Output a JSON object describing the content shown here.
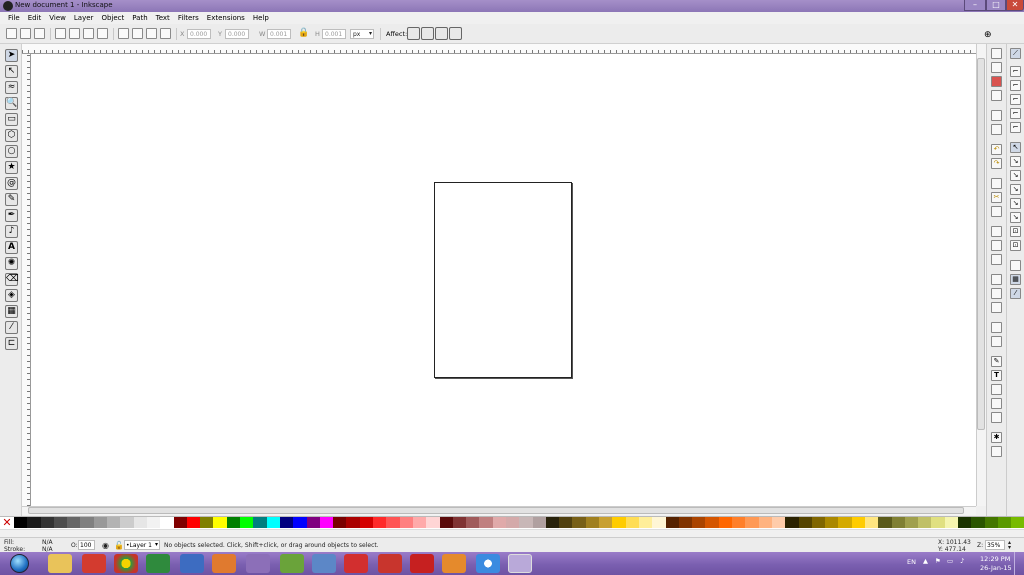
{
  "window": {
    "title": "New document 1 - Inkscape",
    "minimize": "–",
    "maximize": "□",
    "close": "✕"
  },
  "menu": [
    "File",
    "Edit",
    "View",
    "Layer",
    "Object",
    "Path",
    "Text",
    "Filters",
    "Extensions",
    "Help"
  ],
  "toolbar": {
    "x_label": "X",
    "x_value": "0.000",
    "y_label": "Y",
    "y_value": "0.000",
    "w_label": "W",
    "w_value": "0.001",
    "h_label": "H",
    "h_value": "0.001",
    "unit": "px",
    "affect_label": "Affect:"
  },
  "status": {
    "fill_label": "Fill:",
    "fill_value": "N/A",
    "stroke_label": "Stroke:",
    "stroke_value": "N/A",
    "opacity_label": "O:",
    "opacity_value": "100",
    "layer": "•Layer 1",
    "message": "No objects selected. Click, Shift+click, or drag around objects to select.",
    "x_coord": "X: 1011.43",
    "y_coord": "Y: 477.14",
    "zoom_label": "Z:",
    "zoom_value": "35%"
  },
  "tray": {
    "lang": "EN",
    "time": "12:29 PM",
    "date": "26-Jan-15"
  },
  "palette": [
    "#000000",
    "#1a1a1a",
    "#333333",
    "#4d4d4d",
    "#666666",
    "#808080",
    "#999999",
    "#b3b3b3",
    "#cccccc",
    "#e6e6e6",
    "#f2f2f2",
    "#ffffff",
    "#800000",
    "#ff0000",
    "#808000",
    "#ffff00",
    "#008000",
    "#00ff00",
    "#008080",
    "#00ffff",
    "#000080",
    "#0000ff",
    "#800080",
    "#ff00ff",
    "#7a0000",
    "#aa0000",
    "#d40000",
    "#ff2a2a",
    "#ff5555",
    "#ff8080",
    "#ffaaaa",
    "#ffd5d5",
    "#5a0a0a",
    "#803333",
    "#a05a5a",
    "#c08080",
    "#e0aaaa",
    "#d4aaaa",
    "#c8b7b7",
    "#b0a0a0",
    "#28220b",
    "#504010",
    "#786018",
    "#a08020",
    "#c8a030",
    "#ffcc00",
    "#ffdd55",
    "#ffee99",
    "#fff6d5",
    "#552200",
    "#803300",
    "#aa4400",
    "#d45500",
    "#ff6600",
    "#ff7f2a",
    "#ff9955",
    "#ffb380",
    "#ffccaa",
    "#2b2200",
    "#554400",
    "#806600",
    "#aa8800",
    "#d4aa00",
    "#ffcc00",
    "#ffe680",
    "#5a5a1a",
    "#808033",
    "#a0a04d",
    "#c0c066",
    "#e0e080",
    "#f5f5b0",
    "#1a3300",
    "#2a5500",
    "#447700",
    "#5a9900",
    "#77bb00"
  ]
}
